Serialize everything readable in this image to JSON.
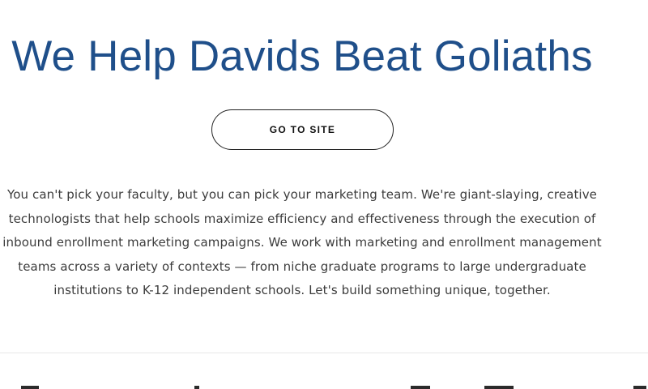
{
  "hero": {
    "title": "We Help Davids Beat Goliaths"
  },
  "cta": {
    "label": "GO TO SITE"
  },
  "description": {
    "lines": [
      "You can't pick your faculty, but you can pick your marketing team. We're giant-slaying, creative",
      "technologists that help schools maximize efficiency and effectiveness through the execution of",
      "inbound enrollment marketing campaigns. We work with marketing and enrollment management",
      "teams across a variety of contexts — from niche graduate programs to large undergraduate",
      "institutions to K-12 independent schools. Let's build something unique, together."
    ]
  },
  "colors": {
    "title": "#1f4f8a",
    "body_text": "#3c3c3c",
    "button_border": "#222222",
    "divider": "#e8e8e8"
  }
}
